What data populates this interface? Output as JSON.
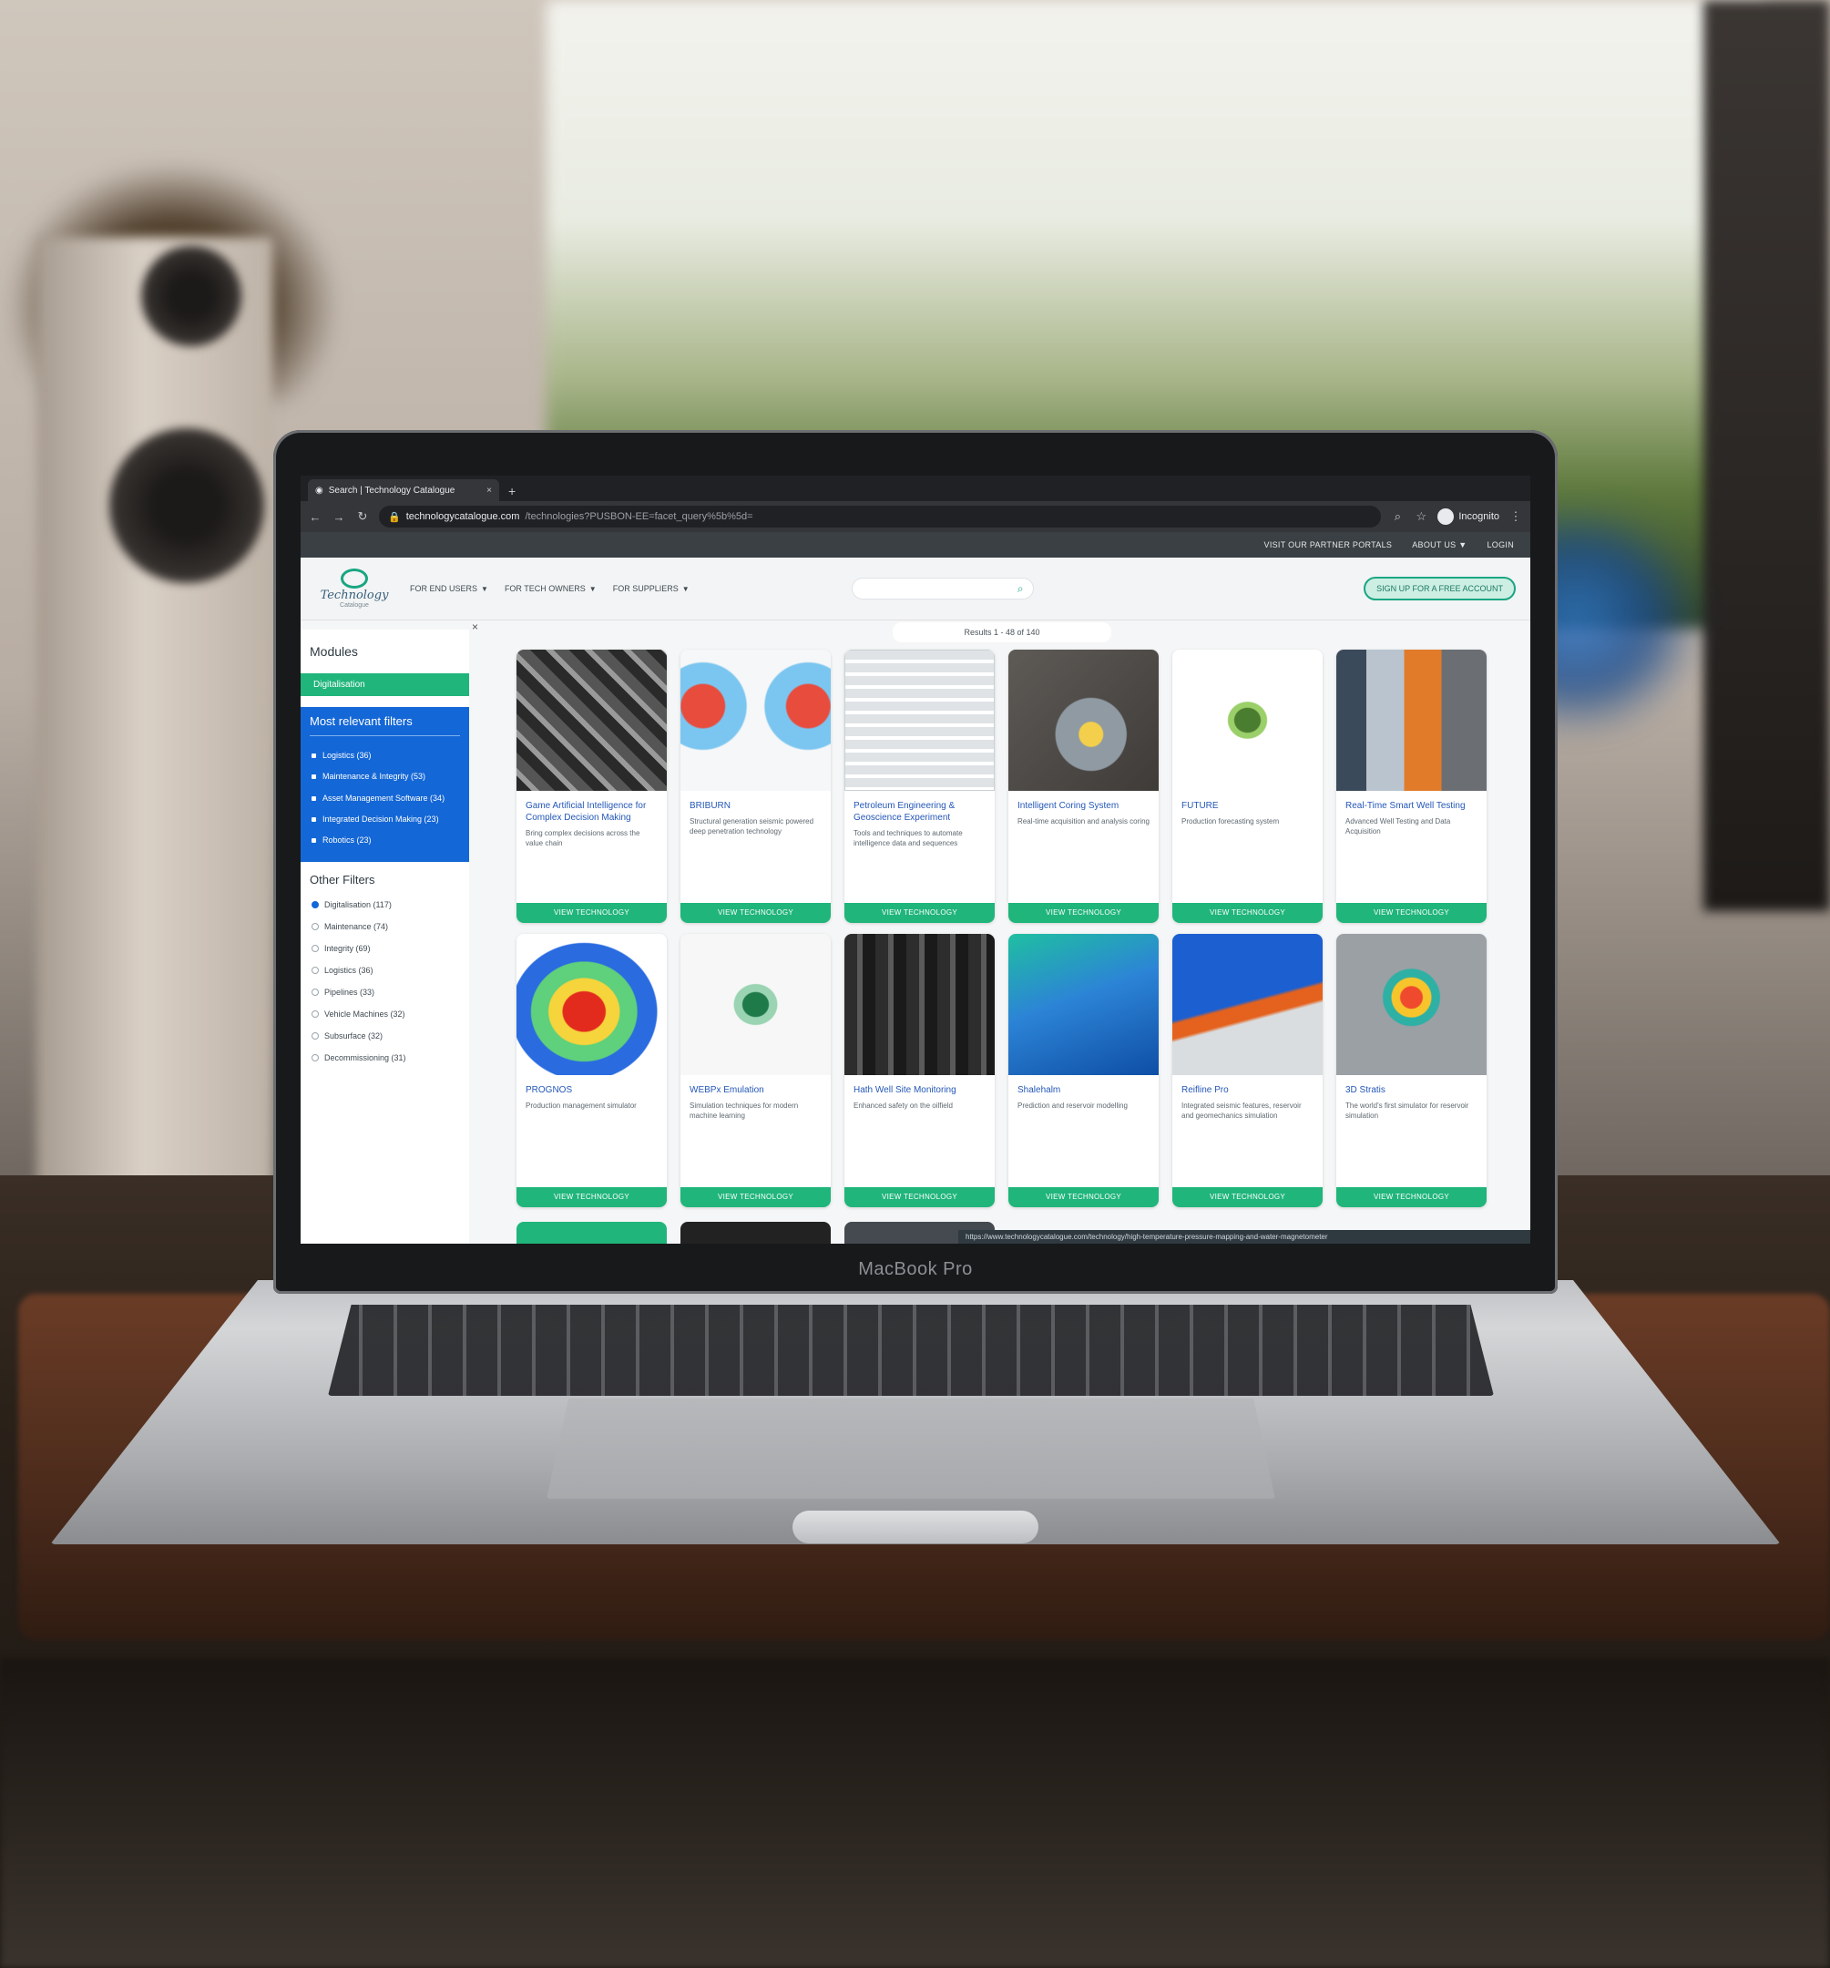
{
  "laptop": {
    "brand": "MacBook Pro"
  },
  "browser": {
    "tab_title": "Search | Technology Catalogue",
    "tab_close": "×",
    "new_tab": "+",
    "url_host": "technologycatalogue.com",
    "url_path": "/technologies?PUSBON-EE=facet_query%5b%5d=",
    "incognito_label": "Incognito",
    "back_icon": "back-arrow-icon",
    "forward_icon": "forward-arrow-icon",
    "reload_icon": "reload-icon"
  },
  "site": {
    "topstrip": [
      "VISIT OUR PARTNER PORTALS",
      "ABOUT US ▼",
      "LOGIN"
    ],
    "logo_text": "Technology",
    "logo_sub": "Catalogue",
    "nav": [
      "FOR END USERS",
      "FOR TECH OWNERS",
      "FOR SUPPLIERS"
    ],
    "signup_label": "SIGN UP FOR A FREE ACCOUNT",
    "results_text": "Results 1 - 48 of 140"
  },
  "sidebar": {
    "modules_heading": "Modules",
    "modules_active": "Digitalisation",
    "relevant_title": "Most relevant filters",
    "relevant_items": [
      "Logistics (36)",
      "Maintenance & Integrity (53)",
      "Asset Management Software (34)",
      "Integrated Decision Making (23)",
      "Robotics (23)"
    ],
    "other_title": "Other Filters",
    "other_items": [
      "Digitalisation (117)",
      "Maintenance (74)",
      "Integrity (69)",
      "Logistics (36)",
      "Pipelines (33)",
      "Vehicle Machines (32)",
      "Subsurface (32)",
      "Decommissioning (31)"
    ]
  },
  "cards": [
    {
      "title": "Game Artificial Intelligence for Complex Decision Making",
      "desc": "Bring complex decisions across the value chain"
    },
    {
      "title": "BRIBURN",
      "desc": "Structural generation seismic powered deep penetration technology"
    },
    {
      "title": "Petroleum Engineering & Geoscience Experiment",
      "desc": "Tools and techniques to automate intelligence data and sequences"
    },
    {
      "title": "Intelligent Coring System",
      "desc": "Real-time acquisition and analysis coring"
    },
    {
      "title": "FUTURE",
      "desc": "Production forecasting system"
    },
    {
      "title": "Real-Time Smart Well Testing",
      "desc": "Advanced Well Testing and Data Acquisition"
    },
    {
      "title": "PROGNOS",
      "desc": "Production management simulator"
    },
    {
      "title": "WEBPx Emulation",
      "desc": "Simulation techniques for modern machine learning"
    },
    {
      "title": "Hath Well Site Monitoring",
      "desc": "Enhanced safety on the oilfield"
    },
    {
      "title": "Shalehalm",
      "desc": "Prediction and reservoir modelling"
    },
    {
      "title": "Reifline Pro",
      "desc": "Integrated seismic features, reservoir and geomechanics simulation"
    },
    {
      "title": "3D Stratis",
      "desc": "The world's first simulator for reservoir simulation"
    }
  ],
  "card_button_label": "VIEW TECHNOLOGY",
  "status_url": "https://www.technologycatalogue.com/technology/high-temperature-pressure-mapping-and-water-magnetometer"
}
